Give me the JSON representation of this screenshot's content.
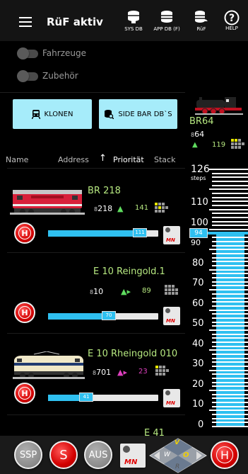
{
  "header": {
    "title": "RüF aktiv",
    "buttons": [
      {
        "label": "SYS DB",
        "icon": "database-sys-icon"
      },
      {
        "label": "APP DB (F)",
        "icon": "database-app-icon"
      },
      {
        "label": "RüF",
        "icon": "database-ruf-icon"
      },
      {
        "label": "HELP",
        "icon": "help-icon",
        "glyph": "?"
      }
    ]
  },
  "toggles": [
    {
      "label": "Fahrzeuge",
      "on": false
    },
    {
      "label": "Zubehör",
      "on": false
    }
  ],
  "actions": {
    "clone_label": "KLONEN",
    "sidebar_label": "SIDE BAR DB`S"
  },
  "columns": {
    "name": "Name",
    "address": "Address",
    "priority": "Priorität",
    "stack": "Stack",
    "sort_arrow": "↑"
  },
  "locos": [
    {
      "name": "BR 218",
      "address": "218",
      "priority": "141",
      "speed": 111,
      "direction": "▲",
      "dir_color": "#5fdc5f",
      "has_image": true
    },
    {
      "name": "E 10 Reingold.1",
      "address": "10",
      "priority": "89",
      "speed": 70,
      "direction": "▲▸",
      "dir_color": "#5fdc5f",
      "has_image": false
    },
    {
      "name": "E 10 Rheingold 010",
      "address": "701",
      "priority": "23",
      "speed": 41,
      "direction": "▲▸",
      "dir_color": "#e040c0",
      "has_image": true
    },
    {
      "name": "E 41",
      "address": "",
      "priority": "",
      "speed": 0,
      "direction": "",
      "dir_color": "#5fdc5f",
      "has_image": false
    }
  ],
  "loco_common": {
    "h_label": "H",
    "mn_label": "MN",
    "addr_glyph": "8"
  },
  "right_panel": {
    "name": "BR64",
    "address": "64",
    "priority": "119",
    "direction": "▲",
    "max_steps": "126",
    "steps_label": "steps",
    "current_speed": 94,
    "scale": [
      "110",
      "100",
      "90",
      "80",
      "70",
      "60",
      "50",
      "40",
      "30",
      "20",
      "10",
      "0"
    ]
  },
  "bottom": {
    "ssp": "SSP",
    "s": "S",
    "aus": "AUS",
    "mn": "MN",
    "h": "H",
    "dir_v": "V",
    "dir_w": "W",
    "dir_o": "O",
    "dir_r": "R"
  },
  "colors": {
    "accent": "#2fc0f0",
    "button": "#a6ecfa",
    "loco_name": "#b6e880",
    "stop_red": "#d40000"
  }
}
